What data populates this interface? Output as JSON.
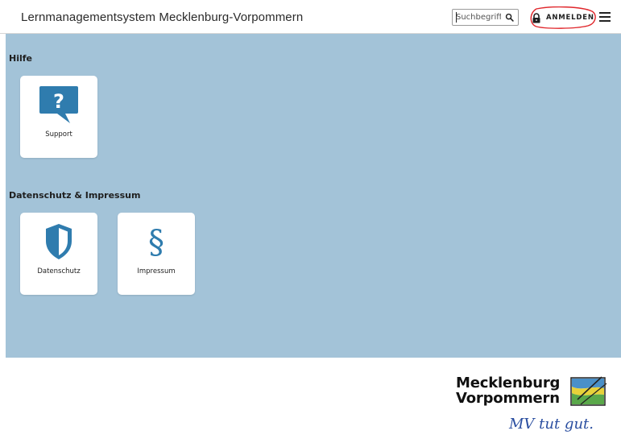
{
  "header": {
    "title": "Lernmanagementsystem Mecklenburg-Vorpommern",
    "search": {
      "placeholder": "Suchbegriff",
      "icon": "search-icon"
    },
    "login": {
      "label": "ANMELDEN",
      "icon": "lock-icon"
    },
    "menu_icon": "hamburger-icon"
  },
  "sections": [
    {
      "title": "Hilfe",
      "tiles": [
        {
          "label": "Support",
          "icon": "question-bubble-icon"
        }
      ]
    },
    {
      "title": "Datenschutz & Impressum",
      "tiles": [
        {
          "label": "Datenschutz",
          "icon": "shield-icon"
        },
        {
          "label": "Impressum",
          "icon": "paragraph-icon"
        }
      ]
    }
  ],
  "logo": {
    "line1": "Mecklenburg",
    "line2": "Vorpommern",
    "slogan": "MV tut gut."
  },
  "colors": {
    "main_background": "#a3c3d8",
    "icon_blue": "#2f7cae",
    "login_highlight": "#e0262b"
  }
}
